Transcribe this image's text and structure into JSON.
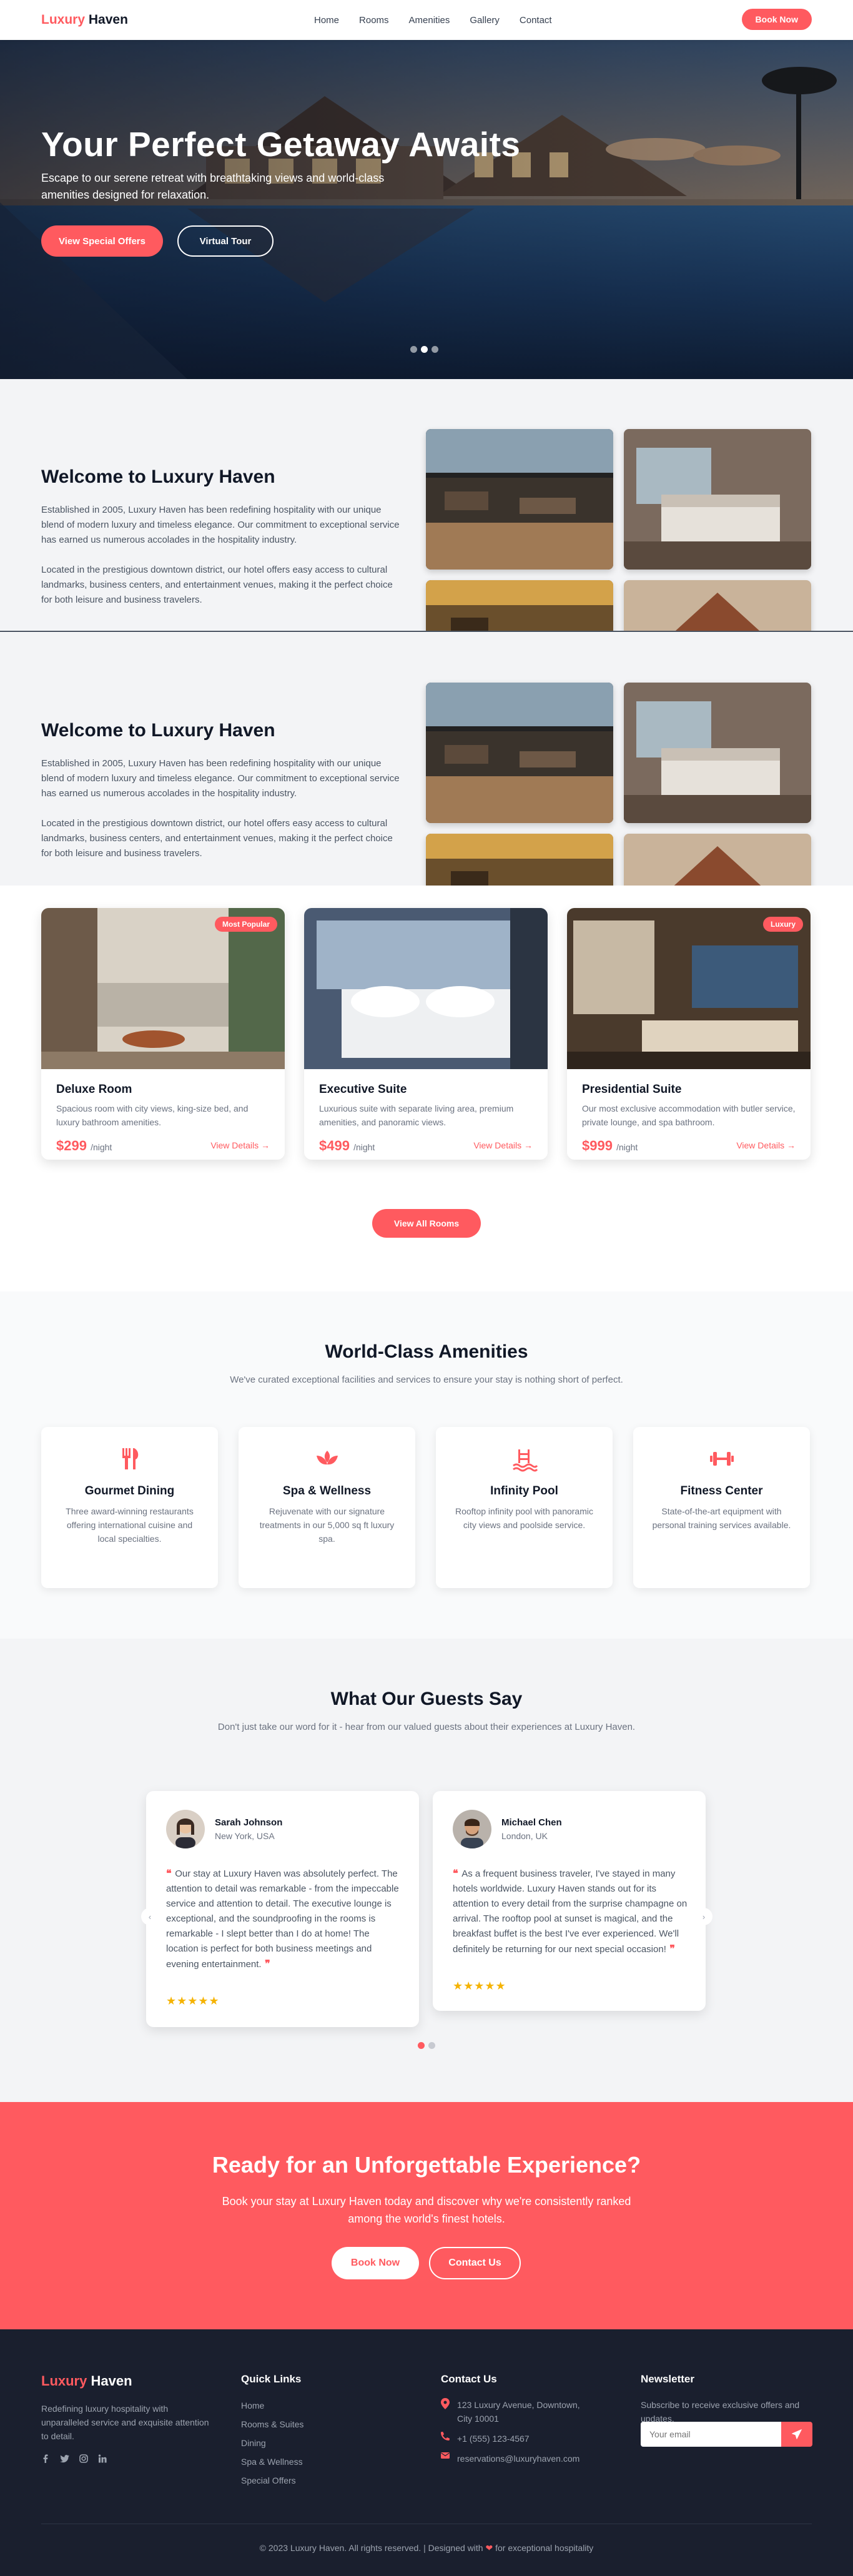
{
  "nav": {
    "logo_brand": "Luxury",
    "logo_rest": "Haven",
    "links": [
      "Home",
      "Rooms",
      "Amenities",
      "Gallery",
      "Contact"
    ],
    "cta": "Book Now"
  },
  "hero": {
    "title": "Your Perfect Getaway Awaits",
    "subtitle": "Escape to our serene retreat with breathtaking views and world-class amenities designed for relaxation.",
    "primary_button": "View Special Offers",
    "secondary_button": "Virtual Tour",
    "slide_count": 3,
    "active_slide": 2
  },
  "welcome": {
    "title": "Welcome to Luxury Haven",
    "para1": "Established in 2005, Luxury Haven has been redefining hospitality with our unique blend of modern luxury and timeless elegance. Our commitment to exceptional service has earned us numerous accolades in the hospitality industry.",
    "para2": "Located in the prestigious downtown district, our hotel offers easy access to cultural landmarks, business centers, and entertainment venues, making it the perfect choice for both leisure and business travelers."
  },
  "rooms": {
    "cards": [
      {
        "badge": "Most Popular",
        "title": "Deluxe Room",
        "desc": "Spacious room with city views, king-size bed, and luxury bathroom amenities.",
        "price": "$299",
        "per": "/night",
        "link": "View Details →"
      },
      {
        "badge": "",
        "title": "Executive Suite",
        "desc": "Luxurious suite with separate living area, premium amenities, and panoramic views.",
        "price": "$499",
        "per": "/night",
        "link": "View Details →"
      },
      {
        "badge": "Luxury",
        "title": "Presidential Suite",
        "desc": "Our most exclusive accommodation with butler service, private lounge, and spa bathroom.",
        "price": "$999",
        "per": "/night",
        "link": "View Details →"
      }
    ],
    "view_all": "View All Rooms"
  },
  "amenities": {
    "title": "World-Class Amenities",
    "subtitle": "We've curated exceptional facilities and services to ensure your stay is nothing short of perfect.",
    "items": [
      {
        "icon": "utensils-icon",
        "title": "Gourmet Dining",
        "desc": "Three award-winning restaurants offering international cuisine and local specialties."
      },
      {
        "icon": "spa-icon",
        "title": "Spa & Wellness",
        "desc": "Rejuvenate with our signature treatments in our 5,000 sq ft luxury spa."
      },
      {
        "icon": "pool-icon",
        "title": "Infinity Pool",
        "desc": "Rooftop infinity pool with panoramic city views and poolside service."
      },
      {
        "icon": "dumbbell-icon",
        "title": "Fitness Center",
        "desc": "State-of-the-art equipment with personal training services available."
      }
    ]
  },
  "testimonials": {
    "title": "What Our Guests Say",
    "subtitle": "Don't just take our word for it - hear from our valued guests about their experiences at Luxury Haven.",
    "items": [
      {
        "name": "Sarah Johnson",
        "location": "New York, USA",
        "text": "Our stay at Luxury Haven was absolutely perfect. The attention to detail was remarkable - from the impeccable service and attention to detail. The executive lounge is exceptional, and the soundproofing in the rooms is remarkable - I slept better than I do at home! The location is perfect for both business meetings and evening entertainment.",
        "rating": 5
      },
      {
        "name": "Michael Chen",
        "location": "London, UK",
        "text": "As a frequent business traveler, I've stayed in many hotels worldwide. Luxury Haven stands out for its attention to every detail from the surprise champagne on arrival. The rooftop pool at sunset is magical, and the breakfast buffet is the best I've ever experienced. We'll definitely be returning for our next special occasion!",
        "rating": 5
      }
    ],
    "page_count": 2,
    "active_page": 1
  },
  "cta": {
    "title": "Ready for an Unforgettable Experience?",
    "text": "Book your stay at Luxury Haven today and discover why we're consistently ranked among the world's finest hotels.",
    "primary": "Book Now",
    "secondary": "Contact Us"
  },
  "footer": {
    "brand": "Luxury",
    "brand_rest": "Haven",
    "about": "Redefining luxury hospitality with unparalleled service and exquisite attention to detail.",
    "social": [
      "facebook-icon",
      "twitter-icon",
      "instagram-icon",
      "linkedin-icon"
    ],
    "quick_links_title": "Quick Links",
    "quick_links": [
      "Home",
      "Rooms & Suites",
      "Dining",
      "Spa & Wellness",
      "Special Offers"
    ],
    "contact_title": "Contact Us",
    "address": "123 Luxury Avenue, Downtown, City 10001",
    "phone": "+1 (555) 123-4567",
    "email": "reservations@luxuryhaven.com",
    "newsletter_title": "Newsletter",
    "newsletter_text": "Subscribe to receive exclusive offers and updates.",
    "newsletter_placeholder": "Your email",
    "copyright_start": "© 2023 Luxury Haven. All rights reserved. | Designed with",
    "copyright_end": "for exceptional hospitality"
  },
  "colors": {
    "accent": "#ff5a5f",
    "dark": "#111827",
    "footer_bg": "#1a1f2e",
    "star": "#f5b301"
  }
}
